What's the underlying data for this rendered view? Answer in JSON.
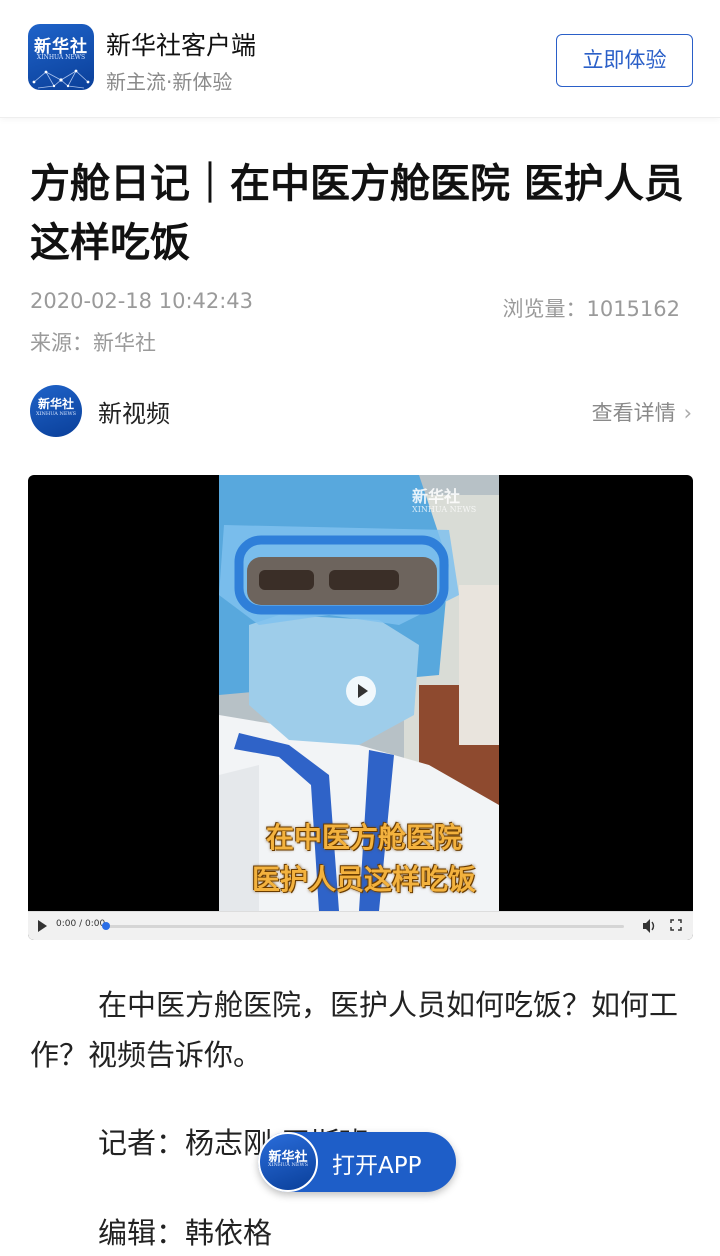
{
  "app_bar": {
    "logo_text": "新华社",
    "logo_subtext": "XINHUA NEWS",
    "name": "新华社客户端",
    "slogan": "新主流·新体验",
    "try_button": "立即体验"
  },
  "article": {
    "title": "方舱日记｜在中医方舱医院 医护人员这样吃饭",
    "datetime": "2020-02-18 10:42:43",
    "views": "浏览量：1015162",
    "source": "来源：新华社"
  },
  "channel": {
    "logo_text": "新华社",
    "logo_subtext": "XINHUA NEWS",
    "name": "新视频",
    "detail_link": "查看详情"
  },
  "video": {
    "watermark": "新华社",
    "watermark_sub": "XINHUA NEWS",
    "caption_line1": "在中医方舱医院",
    "caption_line2": "医护人员这样吃饭",
    "time": "0:00 / 0:00",
    "progress": 0
  },
  "body": {
    "paragraph": "在中医方舱医院，医护人员如何吃饭？如何工作？视频告诉你。",
    "reporter": "记者：杨志刚 王斯班",
    "editor": "编辑：韩依格"
  },
  "open_app": {
    "logo_text": "新华社",
    "logo_subtext": "XINHUA NEWS",
    "label": "打开APP"
  },
  "colors": {
    "brand_blue": "#1e5ec8",
    "caption_orange": "#f3b23e",
    "meta_gray": "#9a9a9a"
  }
}
